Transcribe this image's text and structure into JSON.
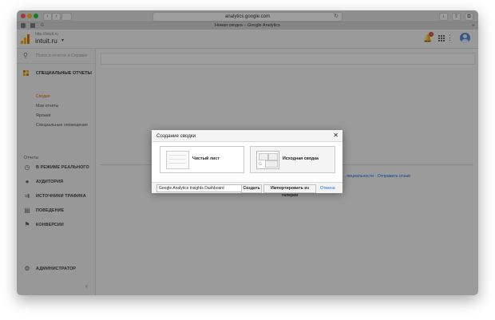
{
  "browser": {
    "url": "analytics.google.com",
    "tab_title": "Новая сводка – Google Analytics",
    "nav_back": "‹",
    "nav_forward": "›",
    "reload_icon": "↻",
    "tab_plus": "+"
  },
  "header": {
    "account_small": "http://intuit.ru",
    "account_name": "intuit.ru",
    "caret": "▾",
    "notification_count": "1",
    "more": "⋮"
  },
  "sidebar": {
    "search_placeholder": "Поиск в отчетах и Справке",
    "custom_section": "СПЕЦИАЛЬНЫЕ ОТЧЕТЫ",
    "sub_items": [
      {
        "label": "Сводки"
      },
      {
        "label": "Мои отчеты"
      },
      {
        "label": "Ярлыки"
      },
      {
        "label": "Специальные оповещения"
      }
    ],
    "reports_label": "Отчеты",
    "nav_items": [
      {
        "label": "В РЕЖИМЕ РЕАЛЬНОГО",
        "icon": "clock-icon",
        "glyph": "◷"
      },
      {
        "label": "АУДИТОРИЯ",
        "icon": "person-icon",
        "glyph": "👤"
      },
      {
        "label": "ИСТОЧНИКИ ТРАФИКА",
        "icon": "acquisition-icon",
        "glyph": "⇉"
      },
      {
        "label": "ПОВЕДЕНИЕ",
        "icon": "behavior-icon",
        "glyph": "▤"
      },
      {
        "label": "КОНВЕРСИИ",
        "icon": "flag-icon",
        "glyph": "⚑"
      }
    ],
    "admin_label": "АДМИНИСТРАТОР",
    "admin_glyph": "⚙",
    "collapse_glyph": "‹"
  },
  "main": {
    "footer_links": "...пециальности · Отправить отзыв"
  },
  "dialog": {
    "title": "Создание сводки",
    "close": "✕",
    "option_blank": "Чистый лист",
    "option_starter": "Исходная сводка",
    "name_value": "Google Analytics Insights Dashboard",
    "create_label": "Создать",
    "import_label": "Импортировать из галереи",
    "cancel_label": "Отмена"
  },
  "colors": {
    "accent_orange": "#e37400",
    "link_blue": "#1a73e8",
    "logo_yellow": "#f4b400"
  }
}
